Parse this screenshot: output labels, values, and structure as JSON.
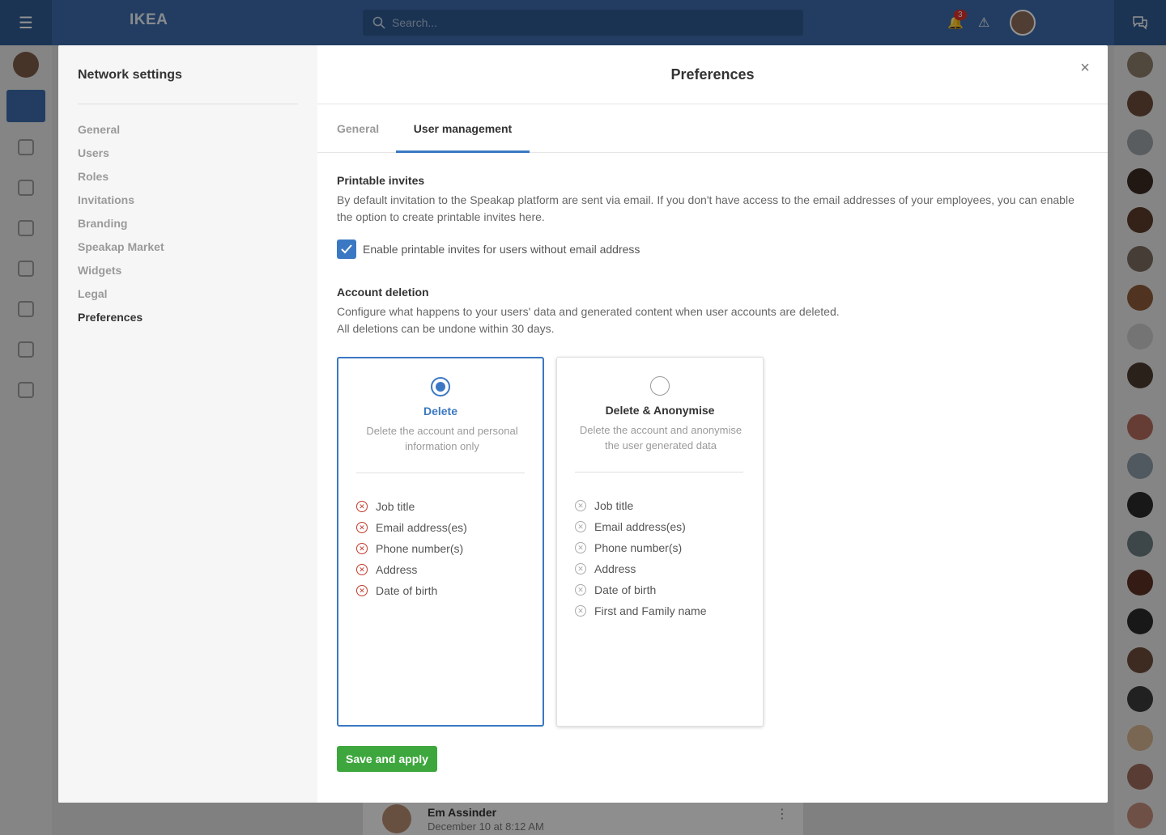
{
  "app": {
    "brand": "IKEA",
    "search_placeholder": "Search...",
    "notification_count": "3",
    "feed_post": {
      "author": "Em Assinder",
      "time": "December 10 at 8:12 AM"
    }
  },
  "colors": {
    "primary": "#3b78c3",
    "topbar": "#3b6aa8",
    "save": "#3da73d",
    "error": "#c0392b"
  },
  "sidebar": {
    "title": "Network settings",
    "items": [
      {
        "label": "General"
      },
      {
        "label": "Users"
      },
      {
        "label": "Roles"
      },
      {
        "label": "Invitations"
      },
      {
        "label": "Branding"
      },
      {
        "label": "Speakap Market"
      },
      {
        "label": "Widgets"
      },
      {
        "label": "Legal"
      },
      {
        "label": "Preferences",
        "active": true
      }
    ]
  },
  "main": {
    "title": "Preferences",
    "tabs": [
      {
        "label": "General"
      },
      {
        "label": "User management",
        "active": true
      }
    ],
    "printable": {
      "title": "Printable invites",
      "description": "By default invitation to the Speakap platform are sent via email. If you don't have access to the email addresses of your employees, you can enable the option to create printable invites here.",
      "checkbox_label": "Enable printable invites for users without email address",
      "checked": true
    },
    "deletion": {
      "title": "Account deletion",
      "description_line1": "Configure what happens to your users' data and generated content when user accounts are deleted.",
      "description_line2": "All deletions can be undone within 30 days.",
      "options": [
        {
          "title": "Delete",
          "description": "Delete the account and personal information only",
          "selected": true,
          "items": [
            "Job title",
            "Email address(es)",
            "Phone number(s)",
            "Address",
            "Date of birth"
          ]
        },
        {
          "title": "Delete & Anonymise",
          "description": "Delete the account and anonymise the user generated data",
          "selected": false,
          "items": [
            "Job title",
            "Email address(es)",
            "Phone number(s)",
            "Address",
            "Date of birth",
            "First and Family name"
          ]
        }
      ]
    },
    "save_label": "Save and apply"
  }
}
